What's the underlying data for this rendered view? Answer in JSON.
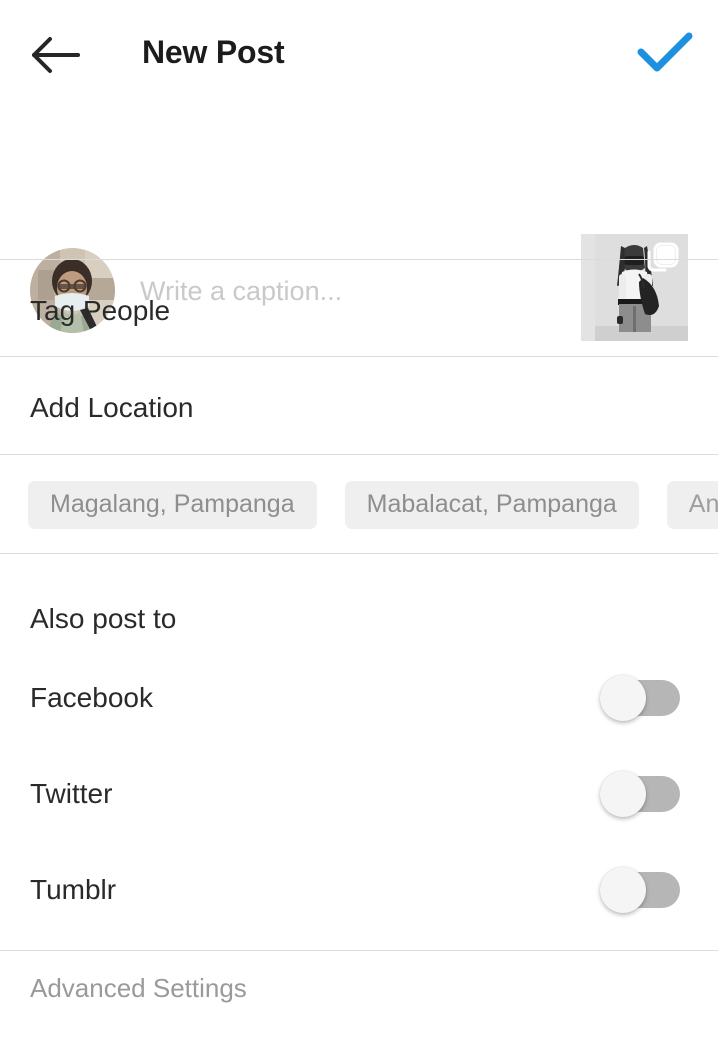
{
  "header": {
    "title": "New Post",
    "back_icon": "arrow-left-icon",
    "share_icon": "check-icon",
    "accent_color": "#1d90e0"
  },
  "caption": {
    "placeholder": "Write a caption...",
    "value": "",
    "avatar_alt": "user-avatar",
    "thumbnail_alt": "post-thumbnail",
    "thumbnail_badge_icon": "multi-photo-icon"
  },
  "menu": {
    "tag_people": "Tag People",
    "add_location": "Add Location"
  },
  "location_suggestions": [
    {
      "label": "Magalang, Pampanga"
    },
    {
      "label": "Mabalacat, Pampanga"
    },
    {
      "label": "Angeles City"
    },
    {
      "label": ""
    }
  ],
  "also_post_to": {
    "heading": "Also post to",
    "services": [
      {
        "name": "Facebook",
        "enabled": false
      },
      {
        "name": "Twitter",
        "enabled": false
      },
      {
        "name": "Tumblr",
        "enabled": false
      }
    ]
  },
  "footer": {
    "advanced_settings": "Advanced Settings"
  },
  "colors": {
    "divider": "#dbdbdb",
    "chip_bg": "#efefef",
    "chip_text": "#8e8e8e",
    "toggle_track_off": "#b6b6b6",
    "toggle_knob": "#f5f5f5",
    "placeholder_text": "#c9c9c9",
    "primary_text": "#2a2a2a",
    "muted_text": "#9a9a9a"
  }
}
